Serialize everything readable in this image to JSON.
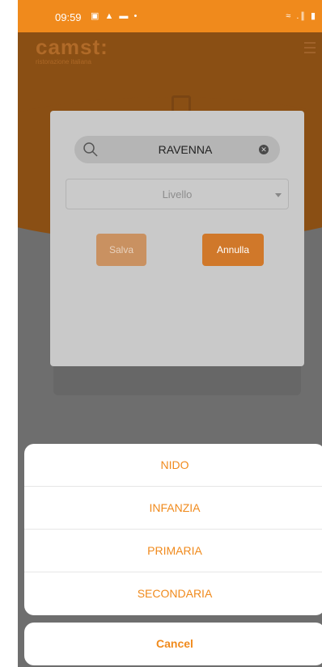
{
  "status_bar": {
    "time": "09:59",
    "notification_icons": "▣ ▲ ▬ •",
    "system_icons": "≈ .∥ ▮"
  },
  "app_header": {
    "brand": "camst:",
    "tagline": "ristorazione italiana"
  },
  "dialog": {
    "search_value": "RAVENNA",
    "level_placeholder": "Livello",
    "save_label": "Salva",
    "cancel_label": "Annulla"
  },
  "action_sheet": {
    "options": [
      {
        "label": "NIDO"
      },
      {
        "label": "INFANZIA"
      },
      {
        "label": "PRIMARIA"
      },
      {
        "label": "SECONDARIA"
      }
    ],
    "cancel_label": "Cancel"
  },
  "colors": {
    "accent": "#f08a1c",
    "header_dimmed": "#8a4f14",
    "overlay": "#6e6e6e"
  }
}
